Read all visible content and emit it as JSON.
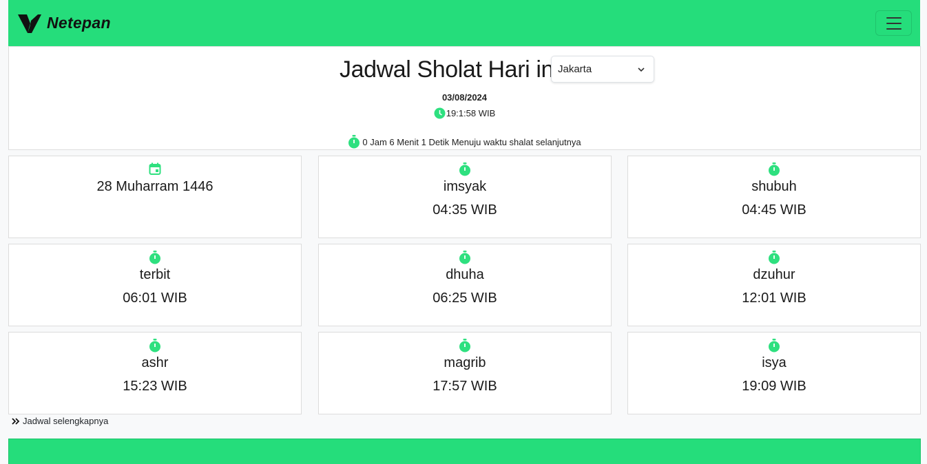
{
  "navbar": {
    "brand_name": "Netepan",
    "brand_logo": "v-logo-icon",
    "menu_icon": "hamburger-menu-icon",
    "bg_color": "#25dd7b"
  },
  "header": {
    "title": "Jadwal Sholat Hari ini",
    "city_selected": "Jakarta",
    "date": "03/08/2024",
    "clock": "19:1:58 WIB",
    "countdown": "0 Jam 6 Menit 1 Detik Menuju waktu shalat selanjutnya"
  },
  "hijri": {
    "icon": "calendar-icon",
    "label": "28 Muharram 1446"
  },
  "prayers": [
    {
      "name": "imsyak",
      "time": "04:35 WIB"
    },
    {
      "name": "shubuh",
      "time": "04:45 WIB"
    },
    {
      "name": "terbit",
      "time": "06:01 WIB"
    },
    {
      "name": "dhuha",
      "time": "06:25 WIB"
    },
    {
      "name": "dzuhur",
      "time": "12:01 WIB"
    },
    {
      "name": "ashr",
      "time": "15:23 WIB"
    },
    {
      "name": "magrib",
      "time": "17:57 WIB"
    },
    {
      "name": "isya",
      "time": "19:09 WIB"
    }
  ],
  "more_link": "Jadwal selengkapnya",
  "colors": {
    "accent": "#25dd7b",
    "icon_green": "#2ee07f"
  }
}
